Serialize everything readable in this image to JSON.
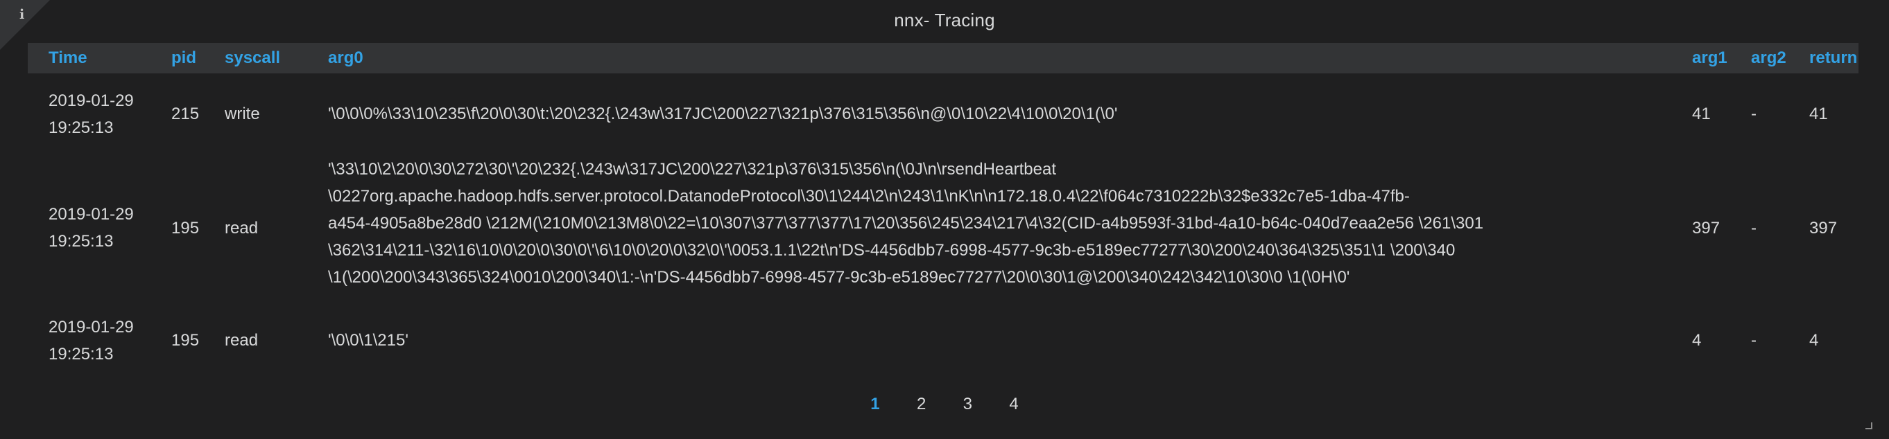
{
  "panel": {
    "title": "nnx- Tracing",
    "info_icon": "info-icon",
    "info_glyph": "i"
  },
  "table": {
    "columns": [
      "Time",
      "pid",
      "syscall",
      "arg0",
      "arg1",
      "arg2",
      "return"
    ],
    "rows": [
      {
        "time_date": "2019-01-29",
        "time_clock": "19:25:13",
        "pid": "215",
        "syscall": "write",
        "arg0": "'\\0\\0\\0%\\33\\10\\235\\f\\20\\0\\30\\t:\\20\\232{.\\243w\\317JC\\200\\227\\321p\\376\\315\\356\\n@\\0\\10\\22\\4\\10\\0\\20\\1(\\0'",
        "arg1": "41",
        "arg2": "-",
        "return": "41"
      },
      {
        "time_date": "2019-01-29",
        "time_clock": "19:25:13",
        "pid": "195",
        "syscall": "read",
        "arg0_lines": [
          "'\\33\\10\\2\\20\\0\\30\\272\\30\\'\\20\\232{.\\243w\\317JC\\200\\227\\321p\\376\\315\\356\\n(\\0J\\n\\rsendHeartbeat",
          "\\0227org.apache.hadoop.hdfs.server.protocol.DatanodeProtocol\\30\\1\\244\\2\\n\\243\\1\\nK\\n\\n172.18.0.4\\22\\f064c7310222b\\32$e332c7e5-1dba-47fb-",
          "a454-4905a8be28d0 \\212M(\\210M0\\213M8\\0\\22=\\10\\307\\377\\377\\377\\17\\20\\356\\245\\234\\217\\4\\32(CID-a4b9593f-31bd-4a10-b64c-040d7eaa2e56 \\261\\301",
          "\\362\\314\\211-\\32\\16\\10\\0\\20\\0\\30\\0\\'\\6\\10\\0\\20\\0\\32\\0\\'\\0053.1.1\\22t\\n'DS-4456dbb7-6998-4577-9c3b-e5189ec77277\\30\\200\\240\\364\\325\\351\\1 \\200\\340",
          "\\1(\\200\\200\\343\\365\\324\\0010\\200\\340\\1:-\\n'DS-4456dbb7-6998-4577-9c3b-e5189ec77277\\20\\0\\30\\1@\\200\\340\\242\\342\\10\\30\\0 \\1(\\0H\\0'"
        ],
        "arg1": "397",
        "arg2": "-",
        "return": "397"
      },
      {
        "time_date": "2019-01-29",
        "time_clock": "19:25:13",
        "pid": "195",
        "syscall": "read",
        "arg0": "'\\0\\0\\1\\215'",
        "arg1": "4",
        "arg2": "-",
        "return": "4"
      }
    ]
  },
  "pagination": {
    "pages": [
      "1",
      "2",
      "3",
      "4"
    ],
    "active": "1"
  },
  "colors": {
    "background": "#1f1f20",
    "header_background": "#333436",
    "accent": "#33a2e5",
    "text": "#d8d9da"
  }
}
